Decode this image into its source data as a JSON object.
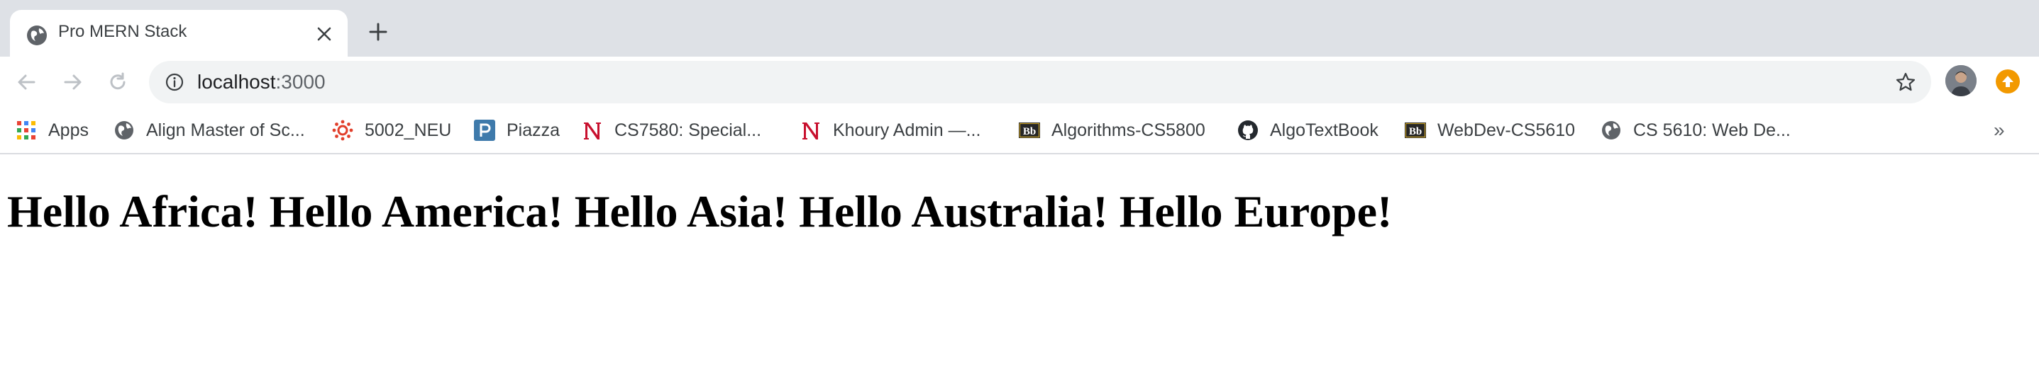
{
  "tab": {
    "title": "Pro MERN Stack"
  },
  "address_bar": {
    "host": "localhost",
    "port": ":3000"
  },
  "bookmarks": [
    {
      "label": "Apps",
      "icon": "apps-grid-icon"
    },
    {
      "label": "Align Master of Sc...",
      "icon": "globe-icon"
    },
    {
      "label": "5002_NEU",
      "icon": "canvas-icon"
    },
    {
      "label": "Piazza",
      "icon": "piazza-icon"
    },
    {
      "label": "CS7580: Special...",
      "icon": "northeastern-n-icon"
    },
    {
      "label": "Khoury Admin —...",
      "icon": "northeastern-n-icon"
    },
    {
      "label": "Algorithms-CS5800",
      "icon": "blackboard-icon"
    },
    {
      "label": "AlgoTextBook",
      "icon": "github-icon"
    },
    {
      "label": "WebDev-CS5610",
      "icon": "blackboard-icon"
    },
    {
      "label": "CS 5610: Web De...",
      "icon": "globe-icon"
    }
  ],
  "page": {
    "heading": "Hello Africa! Hello America! Hello Asia! Hello Australia! Hello Europe!"
  },
  "colors": {
    "tabstrip": "#dee1e6",
    "omnibox": "#f1f3f4",
    "update_badge": "#f29900",
    "northeastern_red": "#c8102e"
  }
}
